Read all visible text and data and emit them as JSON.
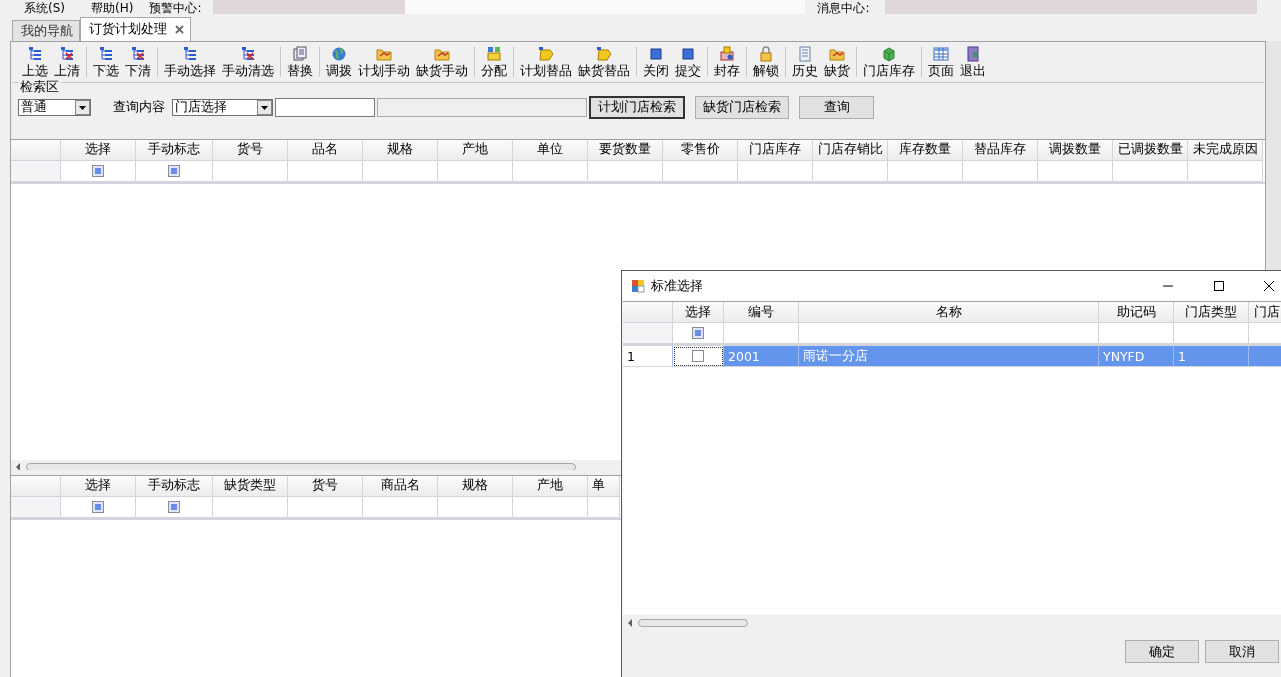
{
  "menu": {
    "items": [
      "系统(S)",
      "帮助(H)"
    ],
    "alert_label": "预警中心:",
    "message_label": "消息中心:"
  },
  "tabs": [
    {
      "label": "我的导航",
      "selected": false,
      "closable": false
    },
    {
      "label": "订货计划处理",
      "selected": true,
      "closable": true
    }
  ],
  "toolbar": {
    "groups": [
      [
        "上选",
        "上清"
      ],
      [
        "下选",
        "下清"
      ],
      [
        "手动选择",
        "手动清选"
      ],
      [
        "替换"
      ],
      [
        "调拨",
        "计划手动",
        "缺货手动"
      ],
      [
        "分配"
      ],
      [
        "计划替品",
        "缺货替品"
      ],
      [
        "关闭",
        "提交"
      ],
      [
        "封存"
      ],
      [
        "解锁"
      ],
      [
        "历史",
        "缺货"
      ],
      [
        "门店库存"
      ],
      [
        "页面",
        "退出"
      ]
    ]
  },
  "search": {
    "title": "检索区",
    "mode": "普通",
    "query_label": "查询内容",
    "query_type": "门店选择",
    "buttons": [
      {
        "label": "计划门店检索",
        "default": true
      },
      {
        "label": "缺货门店检索",
        "default": false
      },
      {
        "label": "查询",
        "default": false
      }
    ]
  },
  "plan_grid": {
    "columns": [
      {
        "label": "选择",
        "kind": "check",
        "filter_indeterminate": true
      },
      {
        "label": "手动标志",
        "kind": "check",
        "filter_indeterminate": true
      },
      {
        "label": "货号",
        "kind": "text"
      },
      {
        "label": "品名",
        "kind": "text"
      },
      {
        "label": "规格",
        "kind": "text"
      },
      {
        "label": "产地",
        "kind": "text"
      },
      {
        "label": "单位",
        "kind": "text"
      },
      {
        "label": "要货数量",
        "kind": "text"
      },
      {
        "label": "零售价",
        "kind": "text"
      },
      {
        "label": "门店库存",
        "kind": "text"
      },
      {
        "label": "门店存销比",
        "kind": "text"
      },
      {
        "label": "库存数量",
        "kind": "text"
      },
      {
        "label": "替品库存",
        "kind": "text"
      },
      {
        "label": "调拨数量",
        "kind": "text"
      },
      {
        "label": "已调拨数量",
        "kind": "text"
      },
      {
        "label": "未完成原因",
        "kind": "text"
      }
    ]
  },
  "shortage_grid": {
    "columns": [
      {
        "label": "选择",
        "kind": "check",
        "filter_indeterminate": true
      },
      {
        "label": "手动标志",
        "kind": "check",
        "filter_indeterminate": true
      },
      {
        "label": "缺货类型",
        "kind": "text"
      },
      {
        "label": "货号",
        "kind": "text"
      },
      {
        "label": "商品名",
        "kind": "text"
      },
      {
        "label": "规格",
        "kind": "text"
      },
      {
        "label": "产地",
        "kind": "text"
      },
      {
        "label": "单",
        "kind": "text"
      }
    ]
  },
  "dialog": {
    "title": "标准选择",
    "columns": [
      {
        "label": "选择",
        "kind": "check",
        "filter_indeterminate": true
      },
      {
        "label": "编号",
        "kind": "text"
      },
      {
        "label": "名称",
        "kind": "text"
      },
      {
        "label": "助记码",
        "kind": "text"
      },
      {
        "label": "门店类型",
        "kind": "text"
      },
      {
        "label": "门店",
        "kind": "text"
      }
    ],
    "rows": [
      {
        "row_header": "1",
        "selected": true,
        "checked": false,
        "cells": [
          "",
          "2001",
          "雨诺一分店",
          "YNYFD",
          "1",
          ""
        ]
      }
    ],
    "buttons": [
      "确定",
      "取消"
    ]
  }
}
